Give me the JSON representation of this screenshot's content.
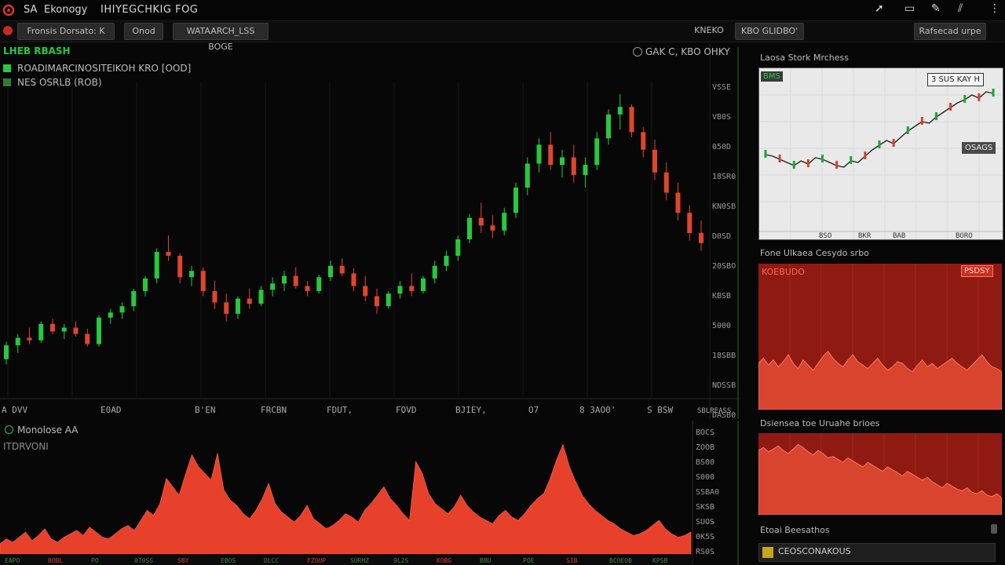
{
  "titlebar": {
    "logo": "red-logo-icon",
    "app_short": "SA",
    "app_name": "Ekonogy",
    "title": "IHIYEGCHKIG FOG",
    "icons": [
      "cursor-icon",
      "window-icon",
      "edit-icon",
      "chart-icon",
      "menu-dots-icon"
    ]
  },
  "toolbar": {
    "tab1": "Fronsis Dorsato: K",
    "tab2": "Onod",
    "tab3": "WATAARCH_LSS BOGE",
    "ticker": "KNEKO",
    "dropdown": "KBO GLIDBO'",
    "right_field": "Rafsecad urpe"
  },
  "main": {
    "title": "LHEB RBASH",
    "legend": [
      {
        "text": "ROADIMARCINOSITEIKOH KRO [OOD]",
        "color": "#27c93f"
      },
      {
        "text": "NES OSRLB (ROB)",
        "color": "#2d7d36"
      }
    ],
    "indicator": "GAK C, KBO OHKY",
    "y_ticks": [
      "VSSE",
      "VB0S",
      "050D",
      "18SR0",
      "KN0SB",
      "D0SD",
      "20SBO",
      "KBSB",
      "5000",
      "18SBB",
      "NDSSB",
      "DASB0"
    ],
    "x_ticks": [
      "A DVV",
      "E0AD",
      "B'EN",
      "FRCBN",
      "FDUT,",
      "FOVD",
      "BJIEY,",
      "O7",
      "8 3AO0'",
      "S BSW",
      "SBLREASS"
    ]
  },
  "volume": {
    "title": "Monolose AA",
    "subtitle": "ITDRVONI",
    "y_ticks": [
      "BOCS",
      "ZOOB",
      "BS00",
      "S000",
      "SSBA0",
      "SKSB",
      "SUOS",
      "0K5S",
      "RS0S"
    ],
    "bottom_ticks": [
      "EAPO",
      "BOBL",
      "PO",
      "0T0SS",
      "SBY",
      "EBOS",
      "DLCC",
      "FZOUP",
      "SURHZ",
      "9L2S",
      "KOBG",
      "BBU",
      "POE",
      "SIB",
      "BCOEOB",
      "KPSB"
    ]
  },
  "sidebar": {
    "panel1_title": "Laosa Stork Mrchess",
    "panel1_badge": "BMS",
    "panel1_tooltip": "3 SUS KAY H",
    "panel1_ylabel": "OSAGS",
    "panel1_xticks": [
      "BSO",
      "BKR",
      "BAB",
      "BORO"
    ],
    "panel2_title": "Fone Ulkaea Cesydo srbo",
    "panel2_badge": "PSDSY",
    "panel2_badge_sub": "KOEBUDO",
    "panel3_title": "Dsiensea toe Uruahe brioes",
    "footer_title": "Etoai Beesathos",
    "footer_field": "CEOSCONAKOUS"
  },
  "colors": {
    "up": "#27c93f",
    "down": "#e0452e",
    "volume": "#e8412b",
    "grid": "#171717"
  },
  "chart_data": [
    {
      "type": "candlestick",
      "title": "LHEB RBASH",
      "series": [
        {
          "name": "ROADIMARCINOSITEIKOH KRO [OOD]",
          "values": [
            [
              30,
              44,
              26,
              41
            ],
            [
              41,
              50,
              35,
              47
            ],
            [
              47,
              55,
              42,
              45
            ],
            [
              45,
              60,
              43,
              58
            ],
            [
              58,
              62,
              50,
              52
            ],
            [
              52,
              58,
              46,
              55
            ],
            [
              55,
              60,
              48,
              50
            ],
            [
              50,
              54,
              40,
              42
            ],
            [
              42,
              65,
              40,
              63
            ],
            [
              63,
              70,
              58,
              67
            ],
            [
              67,
              75,
              62,
              72
            ],
            [
              72,
              86,
              68,
              84
            ],
            [
              84,
              96,
              80,
              94
            ],
            [
              94,
              118,
              90,
              115
            ],
            [
              115,
              128,
              108,
              112
            ],
            [
              112,
              114,
              90,
              95
            ],
            [
              95,
              104,
              88,
              100
            ],
            [
              100,
              103,
              80,
              84
            ],
            [
              84,
              92,
              70,
              75
            ],
            [
              75,
              82,
              60,
              66
            ],
            [
              66,
              80,
              62,
              78
            ],
            [
              78,
              86,
              70,
              74
            ],
            [
              74,
              88,
              72,
              85
            ],
            [
              85,
              95,
              80,
              90
            ],
            [
              90,
              100,
              84,
              96
            ],
            [
              96,
              103,
              86,
              88
            ],
            [
              88,
              92,
              80,
              84
            ],
            [
              84,
              97,
              82,
              95
            ],
            [
              95,
              108,
              92,
              104
            ],
            [
              104,
              110,
              96,
              98
            ],
            [
              98,
              102,
              84,
              88
            ],
            [
              88,
              96,
              76,
              80
            ],
            [
              80,
              86,
              66,
              72
            ],
            [
              72,
              84,
              70,
              82
            ],
            [
              82,
              92,
              78,
              88
            ],
            [
              88,
              98,
              80,
              84
            ],
            [
              84,
              96,
              82,
              94
            ],
            [
              94,
              108,
              90,
              104
            ],
            [
              104,
              116,
              100,
              112
            ],
            [
              112,
              128,
              108,
              125
            ],
            [
              125,
              145,
              122,
              142
            ],
            [
              142,
              154,
              130,
              136
            ],
            [
              136,
              144,
              126,
              132
            ],
            [
              132,
              150,
              128,
              146
            ],
            [
              146,
              170,
              142,
              166
            ],
            [
              166,
              190,
              160,
              185
            ],
            [
              185,
              205,
              178,
              200
            ],
            [
              200,
              210,
              180,
              184
            ],
            [
              184,
              196,
              174,
              190
            ],
            [
              190,
              200,
              170,
              176
            ],
            [
              176,
              190,
              166,
              184
            ],
            [
              184,
              210,
              180,
              205
            ],
            [
              205,
              228,
              200,
              224
            ],
            [
              224,
              240,
              212,
              230
            ],
            [
              230,
              232,
              206,
              210
            ],
            [
              210,
              214,
              190,
              196
            ],
            [
              196,
              204,
              172,
              178
            ],
            [
              178,
              186,
              156,
              162
            ],
            [
              162,
              170,
              140,
              146
            ],
            [
              146,
              152,
              124,
              130
            ],
            [
              130,
              140,
              116,
              122
            ]
          ]
        },
        {
          "name": "NES OSRLB (ROB)",
          "values": []
        }
      ],
      "xlabel": "",
      "ylabel": ""
    },
    {
      "type": "area",
      "title": "Monolose AA",
      "series": [
        {
          "name": "ITDRVONI",
          "values": [
            12,
            18,
            14,
            20,
            26,
            16,
            22,
            30,
            18,
            14,
            20,
            24,
            28,
            22,
            32,
            26,
            20,
            18,
            24,
            30,
            34,
            28,
            40,
            52,
            46,
            60,
            90,
            80,
            70,
            95,
            118,
            104,
            96,
            88,
            120,
            76,
            64,
            58,
            48,
            42,
            52,
            66,
            84,
            60,
            50,
            44,
            38,
            46,
            58,
            42,
            36,
            30,
            34,
            40,
            48,
            44,
            38,
            52,
            60,
            70,
            80,
            66,
            58,
            48,
            40,
            110,
            96,
            72,
            60,
            54,
            48,
            56,
            70,
            58,
            50,
            44,
            40,
            36,
            46,
            52,
            44,
            40,
            48,
            58,
            66,
            72,
            90,
            112,
            130,
            104,
            86,
            70,
            60,
            52,
            46,
            40,
            36,
            30,
            26,
            22,
            24,
            28,
            34,
            40,
            30,
            24,
            20,
            22,
            26
          ]
        }
      ]
    },
    {
      "type": "line",
      "title": "Laosa Stork Mrchess",
      "series": [
        {
          "name": "",
          "values": [
            40,
            38,
            34,
            30,
            26,
            32,
            28,
            36,
            34,
            30,
            26,
            24,
            32,
            30,
            38,
            46,
            52,
            58,
            54,
            62,
            70,
            76,
            82,
            80,
            88,
            94,
            100,
            106,
            110,
            116,
            112,
            120,
            118
          ]
        }
      ]
    },
    {
      "type": "area",
      "title": "Fone Ulkaea Cesydo srbo",
      "series": [
        {
          "name": "",
          "values": [
            30,
            36,
            28,
            34,
            26,
            32,
            40,
            30,
            24,
            34,
            28,
            22,
            30,
            38,
            44,
            36,
            30,
            26,
            34,
            40,
            32,
            28,
            24,
            30,
            36,
            28,
            22,
            26,
            32,
            30,
            24,
            20,
            28,
            34,
            26,
            30,
            24,
            28,
            32,
            36,
            30,
            26,
            22,
            28,
            34,
            40,
            32,
            26,
            24,
            20
          ]
        }
      ]
    },
    {
      "type": "area",
      "title": "Dsiensea toe Uruahe brioes",
      "series": [
        {
          "name": "",
          "values": [
            80,
            84,
            78,
            82,
            86,
            80,
            76,
            82,
            88,
            84,
            78,
            74,
            80,
            76,
            70,
            72,
            68,
            64,
            70,
            66,
            62,
            58,
            64,
            60,
            56,
            52,
            58,
            54,
            50,
            46,
            52,
            48,
            44,
            40,
            44,
            38,
            34,
            30,
            36,
            32,
            28,
            26,
            30,
            24,
            22,
            26,
            20,
            18,
            22,
            16
          ]
        }
      ]
    }
  ]
}
